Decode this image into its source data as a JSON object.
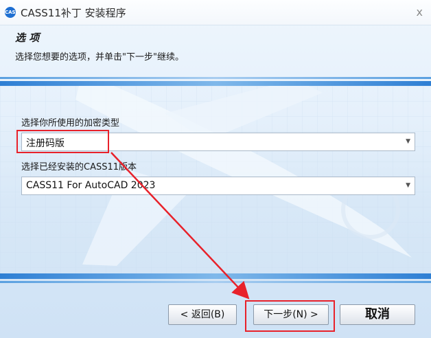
{
  "window": {
    "title": "CASS11补丁 安装程序",
    "app_icon_text": "CASS",
    "close_glyph": "x"
  },
  "header": {
    "title": "选 项",
    "description": "选择您想要的选项，并单击\"下一步\"继续。"
  },
  "form": {
    "encryption": {
      "label": "选择你所使用的加密类型",
      "value": "注册码版"
    },
    "cass_version": {
      "label": "选择已经安装的CASS11版本",
      "value": "CASS11 For AutoCAD 2023"
    },
    "dropdown_arrow": "▼"
  },
  "buttons": {
    "back": "< 返回(B)",
    "next": "下一步(N) >",
    "cancel": "取消"
  },
  "annotations": {
    "highlight_color": "#e8212a"
  }
}
